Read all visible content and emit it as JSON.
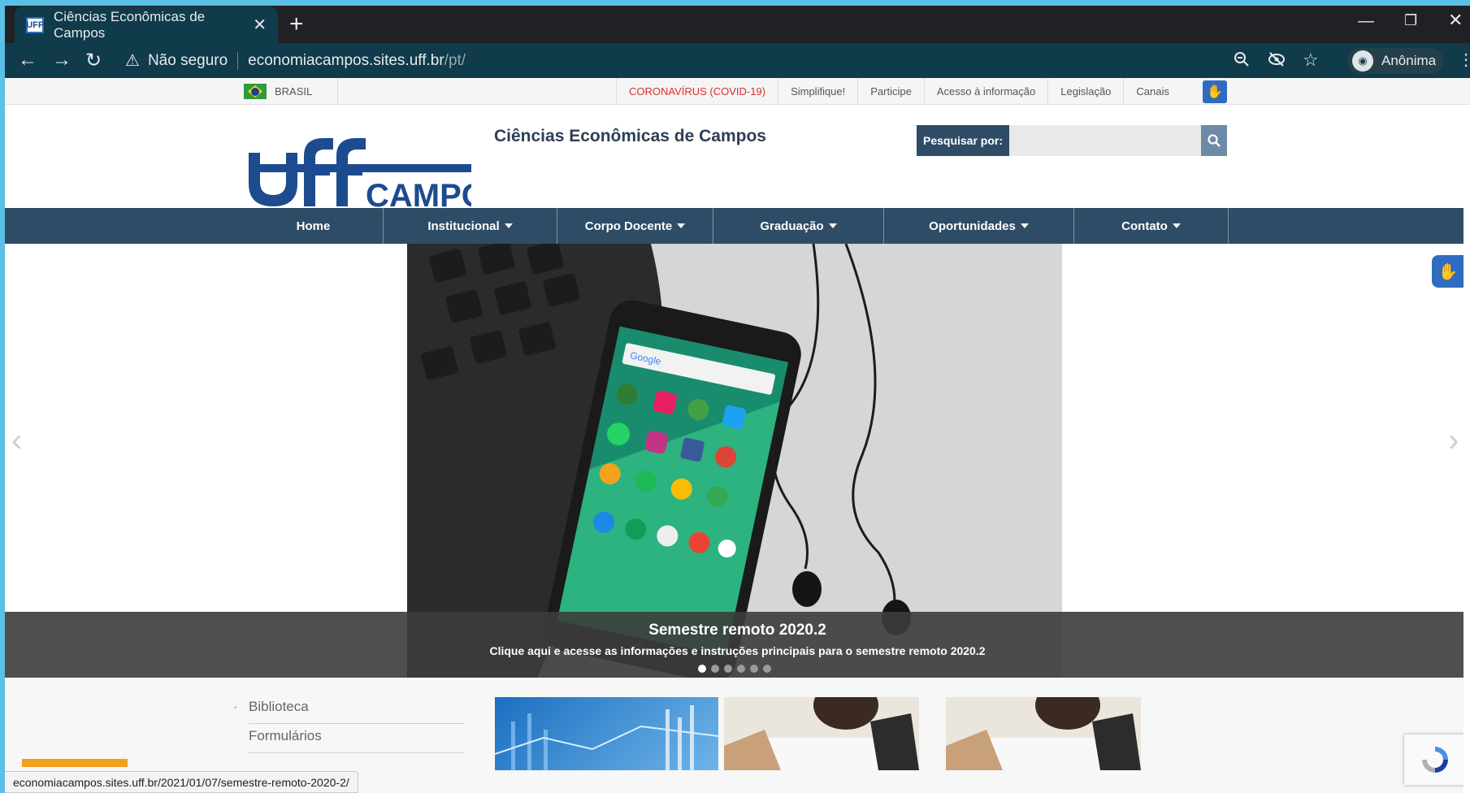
{
  "browser": {
    "tab_title": "Ciências Econômicas de Campos",
    "tab_favicon_text": "UFF",
    "new_tab": "+",
    "url_warning": "Não seguro",
    "url_host": "economiacampos.sites.uff.br",
    "url_path": "/pt/",
    "profile_label": "Anônima",
    "status_url": "economiacampos.sites.uff.br/2021/01/07/semestre-remoto-2020-2/"
  },
  "gov_bar": {
    "country": "BRASIL",
    "links": [
      {
        "label": "CORONAVÍRUS (COVID-19)"
      },
      {
        "label": "Simplifique!"
      },
      {
        "label": "Participe"
      },
      {
        "label": "Acesso à informação"
      },
      {
        "label": "Legislação"
      },
      {
        "label": "Canais"
      }
    ]
  },
  "header": {
    "logo_top": "uff",
    "logo_bottom": "CAMPOS",
    "site_title": "Ciências Econômicas de Campos",
    "search_label": "Pesquisar por:",
    "search_placeholder": ""
  },
  "nav": {
    "items": [
      {
        "label": "Home"
      },
      {
        "label": "Institucional"
      },
      {
        "label": "Corpo Docente"
      },
      {
        "label": "Graduação"
      },
      {
        "label": "Oportunidades"
      },
      {
        "label": "Contato"
      }
    ]
  },
  "carousel": {
    "title": "Semestre remoto 2020.2",
    "text": "Clique aqui e acesse as informações e instruções principais para o semestre remoto 2020.2",
    "slide_count": 6,
    "active_index": 0,
    "phone_search_text": "Google"
  },
  "sidebar": {
    "links": [
      {
        "label": "Biblioteca"
      },
      {
        "label": "Formulários"
      }
    ]
  },
  "colors": {
    "nav_bg": "#2f4c66",
    "chrome_toolbar": "#0f3b4b",
    "covid_red": "#d92d2d",
    "accessibility_blue": "#2f6bc0"
  }
}
